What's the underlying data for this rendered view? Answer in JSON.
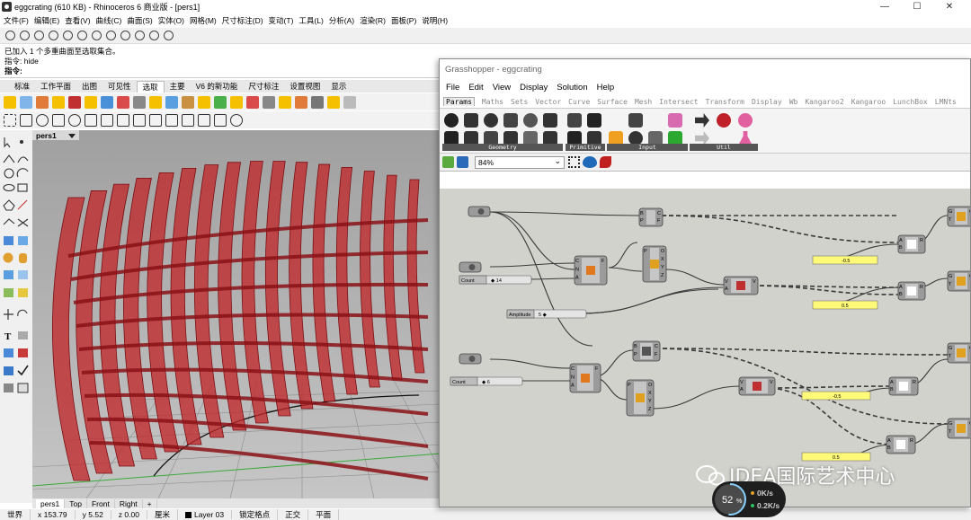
{
  "rhino": {
    "window_title": "eggcrating (610 KB) - Rhinoceros 6 商业版 - [pers1]",
    "window_controls": [
      "—",
      "☐",
      "✕"
    ],
    "menu": [
      "文件(F)",
      "编辑(E)",
      "查看(V)",
      "曲线(C)",
      "曲面(S)",
      "实体(O)",
      "网格(M)",
      "尺寸标注(D)",
      "变动(T)",
      "工具(L)",
      "分析(A)",
      "渲染(R)",
      "面板(P)",
      "说明(H)"
    ],
    "command_history": [
      "已加入 1 个多重曲面至选取集合。",
      "指令: hide",
      "指令:"
    ],
    "toolbar_tabs": [
      "标准",
      "工作平面",
      "出图",
      "可见性",
      "选取",
      "主要",
      "V6 的新功能",
      "尺寸标注",
      "设置视图",
      "显示"
    ],
    "active_toolbar_tab": "选取",
    "viewport": {
      "name": "pers1"
    },
    "view_tabs": [
      "pers1",
      "Top",
      "Front",
      "Right",
      "+"
    ],
    "status": {
      "cplane": "世界",
      "x": "x 153.79",
      "y": "y 5.52",
      "z": "z 0.00",
      "units": "厘米",
      "layer": "Layer 03",
      "snap": "锁定格点",
      "ortho": "正交",
      "planar": "平面"
    }
  },
  "grasshopper": {
    "title": "Grasshopper - eggcrating",
    "menu": [
      "File",
      "Edit",
      "View",
      "Display",
      "Solution",
      "Help"
    ],
    "tabs": [
      "Params",
      "Maths",
      "Sets",
      "Vector",
      "Curve",
      "Surface",
      "Mesh",
      "Intersect",
      "Transform",
      "Display",
      "Wb",
      "Kangaroo2",
      "Kangaroo",
      "LunchBox",
      "LMNts"
    ],
    "active_tab": "Params",
    "ribbon_groups": [
      "Geometry",
      "Primitive",
      "Input",
      "Util"
    ],
    "zoom": "84%",
    "sliders": [
      {
        "label": "Count",
        "value": "◆ 14"
      },
      {
        "label": "Amplitude",
        "value": "5 ◆"
      },
      {
        "label": "Count",
        "value": "◆ 6"
      }
    ],
    "panels": [
      "-0.5",
      "0.5",
      "-0.5",
      "0.5"
    ],
    "node_letters": {
      "c1": [
        "C",
        "N",
        "A",
        "F"
      ],
      "b1": [
        "B",
        "P",
        "C",
        "F"
      ],
      "ml": [
        "P",
        "O",
        "X",
        "Y",
        "Z"
      ],
      "vec": [
        "V",
        "A",
        "V"
      ],
      "mul": [
        "A",
        "B",
        "R"
      ],
      "gt": [
        "G",
        "T",
        "G"
      ]
    }
  },
  "performance": {
    "cpu_percent": "52",
    "cpu_unit": "%",
    "up": "0K/s",
    "down": "0.2K/s"
  },
  "watermark": "IDEA国际艺术中心",
  "colors": {
    "model_red": "#c0282c",
    "slider_panel": "#fffa78",
    "canvas": "#d2d2cd"
  }
}
